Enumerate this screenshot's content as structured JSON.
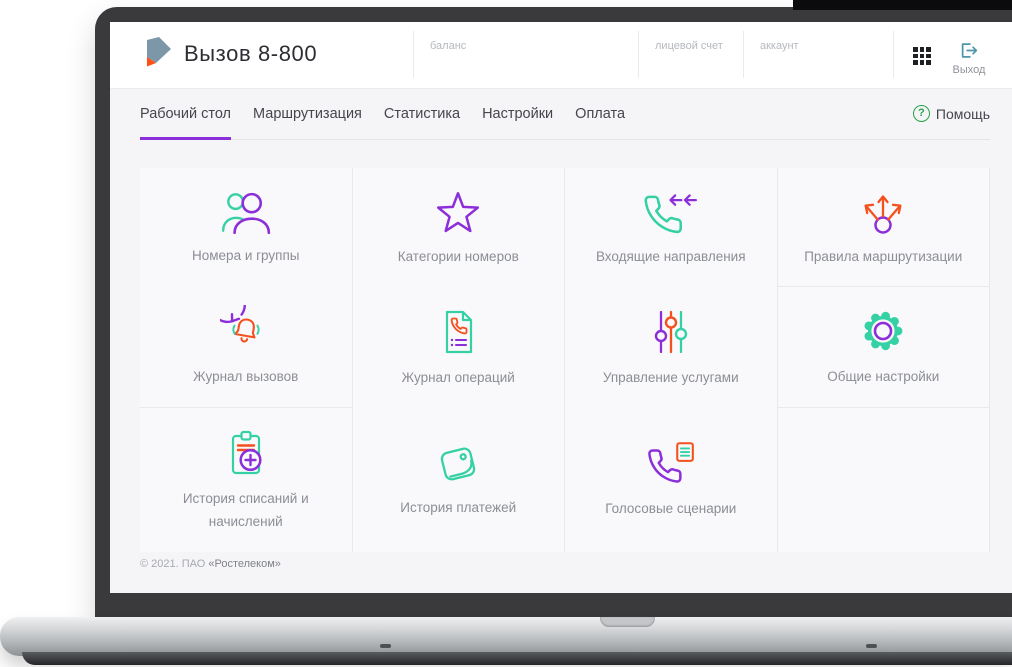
{
  "header": {
    "title": "Вызов 8-800",
    "fields": [
      {
        "label": "баланс"
      },
      {
        "label": "лицевой счет"
      },
      {
        "label": "аккаунт"
      }
    ],
    "logout": {
      "label": "Выход",
      "icon": "logout-icon"
    },
    "apps_icon": "apps-grid-icon",
    "logo_icon": "rostelecom-logo-icon"
  },
  "nav": {
    "tabs": [
      {
        "label": "Рабочий стол",
        "active": true
      },
      {
        "label": "Маршрутизация",
        "active": false
      },
      {
        "label": "Статистика",
        "active": false
      },
      {
        "label": "Настройки",
        "active": false
      },
      {
        "label": "Оплата",
        "active": false
      }
    ],
    "help_label": "Помощь",
    "help_icon": "question-circle-icon"
  },
  "cards": [
    {
      "label": "Номера и группы",
      "icon": "users-icon"
    },
    {
      "label": "Категории номеров",
      "icon": "star-icon"
    },
    {
      "label": "Входящие направления",
      "icon": "incoming-call-icon"
    },
    {
      "label": "Правила маршрутизации",
      "icon": "routing-arrows-icon"
    },
    {
      "label": "Журнал вызовов",
      "icon": "call-log-bell-icon"
    },
    {
      "label": "Журнал операций",
      "icon": "operations-document-icon"
    },
    {
      "label": "Управление услугами",
      "icon": "sliders-icon"
    },
    {
      "label": "Общие настройки",
      "icon": "gear-icon"
    },
    {
      "label": "История списаний и начислений",
      "icon": "clipboard-plus-icon"
    },
    {
      "label": "История платежей",
      "icon": "wallet-icon"
    },
    {
      "label": "Голосовые сценарии",
      "icon": "voice-phone-icon"
    }
  ],
  "footer": {
    "copyright_prefix": "© 2021. ПАО ",
    "brand": "«Ростелеком»"
  },
  "colors": {
    "accent_purple": "#8C2ED9",
    "accent_teal": "#35D1A5",
    "accent_orange": "#F4511E",
    "brand_green": "#27A348",
    "logo_slate": "#7C98A8",
    "logo_orange": "#FF4F12"
  }
}
